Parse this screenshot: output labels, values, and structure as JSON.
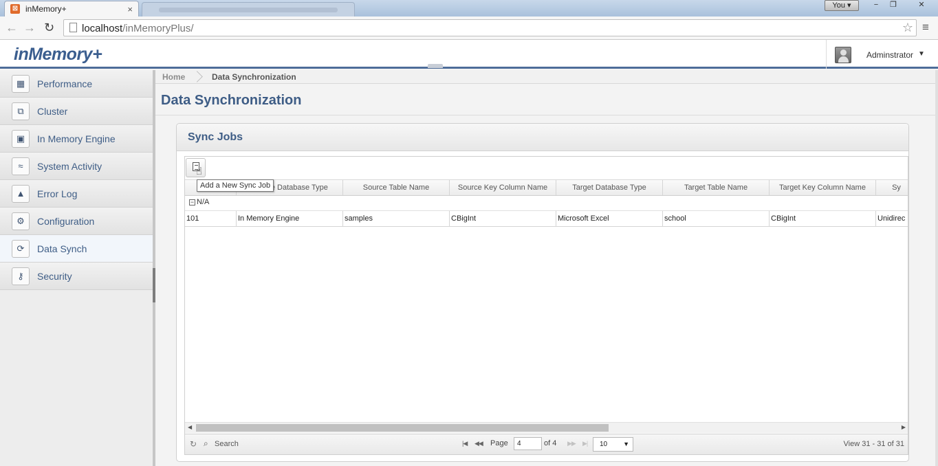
{
  "browser": {
    "tab_title": "inMemory+",
    "tab_close": "×",
    "url_host": "localhost",
    "url_path": "/inMemoryPlus/",
    "window_user": "You",
    "window_buttons": [
      "−",
      "❐",
      "✕"
    ]
  },
  "app": {
    "logo": "inMemory+",
    "user_name": "Adminstrator"
  },
  "sidebar": {
    "items": [
      {
        "label": "Performance",
        "icon": "dashboard-icon",
        "glyph": "▦"
      },
      {
        "label": "Cluster",
        "icon": "cluster-icon",
        "glyph": "⧉"
      },
      {
        "label": "In Memory Engine",
        "icon": "chip-icon",
        "glyph": "▣"
      },
      {
        "label": "System Activity",
        "icon": "activity-icon",
        "glyph": "≈"
      },
      {
        "label": "Error Log",
        "icon": "warning-icon",
        "glyph": "▲"
      },
      {
        "label": "Configuration",
        "icon": "gear-icon",
        "glyph": "⚙"
      },
      {
        "label": "Data Synch",
        "icon": "sync-icon",
        "glyph": "⟳"
      },
      {
        "label": "Security",
        "icon": "key-icon",
        "glyph": "⚷"
      }
    ],
    "active": "Data Synch"
  },
  "breadcrumb": {
    "home": "Home",
    "current": "Data Synchronization"
  },
  "page": {
    "title": "Data Synchronization"
  },
  "panel": {
    "title": "Sync Jobs",
    "add_tooltip": "Add a New Sync Job"
  },
  "grid": {
    "columns": [
      "",
      "Source Database Type",
      "Source Table Name",
      "Source Key Column Name",
      "Target Database Type",
      "Target Table Name",
      "Target Key Column Name",
      "Sy"
    ],
    "group_label": "N/A",
    "rows": [
      [
        "101",
        "In Memory Engine",
        "samples",
        "CBigInt",
        "Microsoft Excel",
        "school",
        "CBigInt",
        "Unidirec"
      ]
    ]
  },
  "pager": {
    "search_label": "Search",
    "page_label": "Page",
    "page_value": "4",
    "of_label": "of 4",
    "rows_per_page": "10",
    "view_text": "View 31 - 31 of 31"
  }
}
